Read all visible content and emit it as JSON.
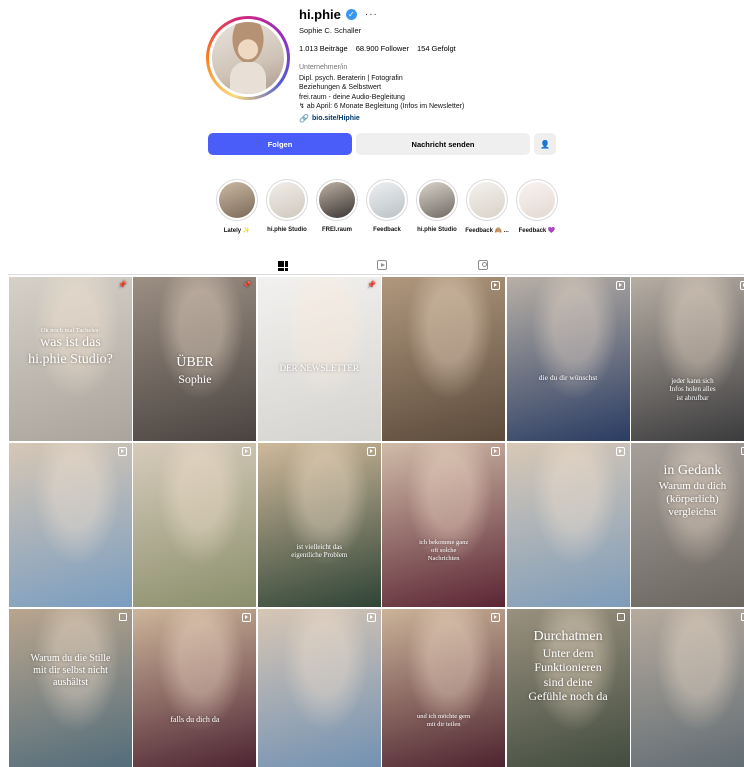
{
  "profile": {
    "username": "hi.phie",
    "full_name": "Sophie C. Schaller",
    "stats": {
      "posts_value": "1.013",
      "posts_label": "Beiträge",
      "followers_value": "68.900",
      "followers_label": "Follower",
      "following_value": "154",
      "following_label": "Gefolgt"
    },
    "category": "Unternehmer/in",
    "bio": [
      "Dipl. psych. Beraterin | Fotografin",
      "Beziehungen & Selbstwert",
      "frei.raum - deine Audio-Begleitung",
      "↯ ab April: 6 Monate Begleitung (Infos im Newsletter)"
    ],
    "link": "bio.site/Hiphie"
  },
  "actions": {
    "follow": "Folgen",
    "message": "Nachricht senden"
  },
  "highlights": [
    {
      "label": "Lately ✨",
      "colors": [
        "#7b6a58",
        "#c9b8a3"
      ]
    },
    {
      "label": "hi.phie Studio",
      "colors": [
        "#cfc8bf",
        "#f1ede8"
      ]
    },
    {
      "label": "FREI.raum",
      "colors": [
        "#3a3433",
        "#bfb2a4"
      ]
    },
    {
      "label": "Feedback",
      "colors": [
        "#b9c2c7",
        "#eef0f1"
      ]
    },
    {
      "label": "hi.phie Studio",
      "colors": [
        "#6f6a63",
        "#d9d3cb"
      ]
    },
    {
      "label": "Feedback 🙈 ...",
      "colors": [
        "#d9d2c9",
        "#f4f1ec"
      ]
    },
    {
      "label": "Feedback 💜",
      "colors": [
        "#e4d8d2",
        "#f8f4f1"
      ]
    }
  ],
  "posts": [
    {
      "type": "pinned",
      "bg": [
        "#a9a49c",
        "#d6d1c8"
      ],
      "lines": [
        "Ok noch mal Tacheles:",
        "was ist das",
        "hi.phie Studio?"
      ]
    },
    {
      "type": "pinned",
      "bg": [
        "#4a4440",
        "#9c8f84"
      ],
      "lines": [
        "ÜBER",
        "Sophie"
      ]
    },
    {
      "type": "pinned",
      "bg": [
        "#d5d3d0",
        "#f2f1ef"
      ],
      "lines": [
        "DER NEWSLETTER"
      ]
    },
    {
      "type": "reel",
      "bg": [
        "#5b4a3b",
        "#b0987e"
      ],
      "lines": []
    },
    {
      "type": "reel",
      "bg": [
        "#2a3c63",
        "#b8b0a6"
      ],
      "lines": [
        "die du dir wünschst"
      ]
    },
    {
      "type": "reel",
      "bg": [
        "#3a3a3c",
        "#b7aea4"
      ],
      "lines": [
        "jeder kann sich",
        "Infos holen alles",
        "ist abrufbar"
      ]
    },
    {
      "type": "reel",
      "bg": [
        "#7a9dc0",
        "#d6c7b5"
      ],
      "lines": []
    },
    {
      "type": "reel",
      "bg": [
        "#8a8f6c",
        "#d7cbbb"
      ],
      "lines": []
    },
    {
      "type": "reel",
      "bg": [
        "#2f4436",
        "#cfb99b"
      ],
      "lines": [
        "ist vielleicht das",
        "eigentliche Problem"
      ]
    },
    {
      "type": "reel",
      "bg": [
        "#5b2533",
        "#d0bba8"
      ],
      "lines": [
        "ich bekomme ganz",
        "oft solche",
        "Nachrichten"
      ]
    },
    {
      "type": "reel",
      "bg": [
        "#7d9cba",
        "#d8c8b6"
      ],
      "lines": []
    },
    {
      "type": "carousel",
      "bg": [
        "#6a655f",
        "#a7a09a"
      ],
      "lines": [
        "in Gedank",
        "Warum du dich",
        "(körperlich)",
        "vergleichst"
      ]
    },
    {
      "type": "carousel",
      "bg": [
        "#4f6b7a",
        "#b9a58e"
      ],
      "lines": [
        "Warum du die Stille",
        "mit dir selbst nicht",
        "aushältst"
      ]
    },
    {
      "type": "reel",
      "bg": [
        "#4a2030",
        "#cdb59a"
      ],
      "lines": [
        "falls du dich da"
      ]
    },
    {
      "type": "reel",
      "bg": [
        "#6f90b3",
        "#d7c6b4"
      ],
      "lines": []
    },
    {
      "type": "reel",
      "bg": [
        "#4a1f2c",
        "#cbb399"
      ],
      "lines": [
        "und ich möchte gern",
        "mit dir teilen"
      ]
    },
    {
      "type": "carousel",
      "bg": [
        "#3f4a3d",
        "#9a917f"
      ],
      "lines": [
        "Durchatmen",
        "Unter dem",
        "Funktionieren",
        "sind deine",
        "Gefühle noch da"
      ]
    },
    {
      "type": "carousel",
      "bg": [
        "#5e6a72",
        "#b7ab9e"
      ],
      "lines": []
    }
  ]
}
